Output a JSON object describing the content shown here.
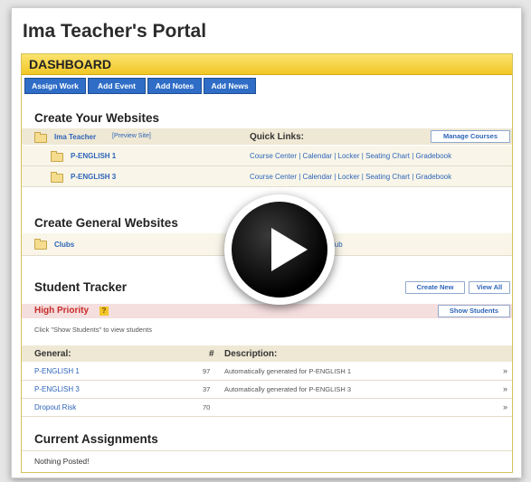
{
  "portal_title": "Ima Teacher's Portal",
  "dashboard": {
    "header": "DASHBOARD",
    "buttons": [
      "Assign Work",
      "Add Event",
      "Add Notes",
      "Add News"
    ]
  },
  "websites": {
    "title": "Create Your Websites",
    "owner": "Ima Teacher",
    "preview": "[Preview Site]",
    "quick_links_label": "Quick Links:",
    "manage_courses": "Manage Courses",
    "courses": [
      {
        "name": "P-ENGLISH 1",
        "links": "Course Center | Calendar | Locker | Seating Chart | Gradebook"
      },
      {
        "name": "P-ENGLISH 3",
        "links": "Course Center | Calendar | Locker | Seating Chart | Gradebook"
      }
    ]
  },
  "general_websites": {
    "title": "Create General Websites",
    "clubs": "Clubs",
    "club_link": "lub"
  },
  "tracker": {
    "title": "Student Tracker",
    "create_new": "Create New",
    "view_all": "View All",
    "high_priority": "High Priority",
    "help_mark": "?",
    "show_students": "Show Students",
    "hint": "Click \"Show Students\" to view students",
    "columns": {
      "general": "General:",
      "count": "#",
      "description": "Description:"
    },
    "rows": [
      {
        "general": "P-ENGLISH 1",
        "count": "97",
        "description": "Automatically generated for P-ENGLISH 1",
        "action": "»"
      },
      {
        "general": "P-ENGLISH 3",
        "count": "37",
        "description": "Automatically generated for P-ENGLISH 3",
        "action": "»"
      },
      {
        "general": "Dropout Risk",
        "count": "70",
        "description": "",
        "action": "»"
      }
    ]
  },
  "assignments": {
    "title": "Current Assignments",
    "empty": "Nothing Posted!"
  },
  "video_overlay": {
    "icon": "play-icon"
  },
  "colors": {
    "accent_yellow": "#f1c726",
    "button_blue": "#2f6dc6",
    "link_blue": "#2e64b8",
    "priority_red": "#c72a2a"
  }
}
